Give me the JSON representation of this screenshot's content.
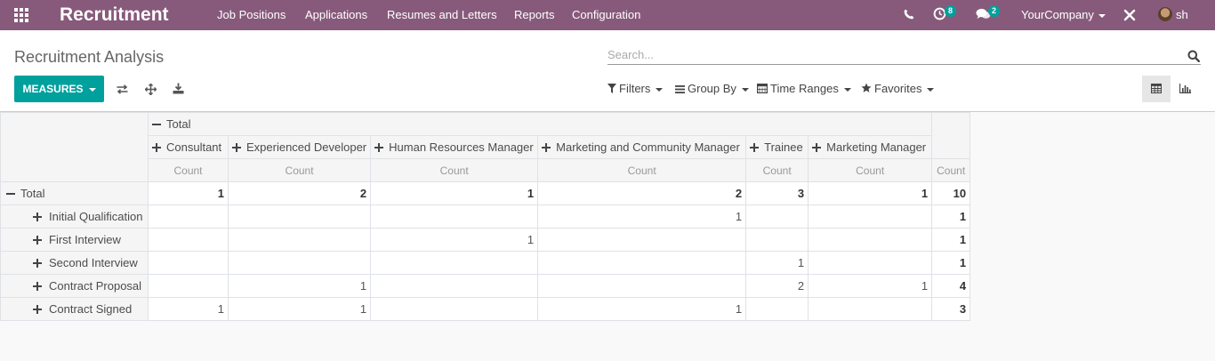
{
  "app": {
    "title": "Recruitment",
    "menu": [
      "Job Positions",
      "Applications",
      "Resumes and Letters",
      "Reports",
      "Configuration"
    ],
    "activity_count": "8",
    "message_count": "2",
    "company": "YourCompany",
    "user": "sh"
  },
  "page": {
    "title": "Recruitment Analysis",
    "search_placeholder": "Search...",
    "measures_label": "MEASURES",
    "filters": [
      "Filters",
      "Group By",
      "Time Ranges",
      "Favorites"
    ]
  },
  "pivot": {
    "col_total_label": "Total",
    "columns": [
      "Consultant",
      "Experienced Developer",
      "Human Resources Manager",
      "Marketing and Community Manager",
      "Trainee",
      "Marketing Manager"
    ],
    "measure": "Count",
    "rows": [
      {
        "label": "Total",
        "cells": [
          "1",
          "2",
          "1",
          "2",
          "3",
          "1"
        ],
        "total": "10"
      },
      {
        "label": "Initial Qualification",
        "cells": [
          "",
          "",
          "",
          "1",
          "",
          ""
        ],
        "total": "1"
      },
      {
        "label": "First Interview",
        "cells": [
          "",
          "",
          "1",
          "",
          "",
          ""
        ],
        "total": "1"
      },
      {
        "label": "Second Interview",
        "cells": [
          "",
          "",
          "",
          "",
          "1",
          ""
        ],
        "total": "1"
      },
      {
        "label": "Contract Proposal",
        "cells": [
          "",
          "1",
          "",
          "",
          "2",
          "1"
        ],
        "total": "4"
      },
      {
        "label": "Contract Signed",
        "cells": [
          "1",
          "1",
          "",
          "1",
          "",
          ""
        ],
        "total": "3"
      }
    ]
  },
  "colors": {
    "navbar": "#875a7b",
    "primary": "#00a09d"
  },
  "icons": {
    "apps": "apps-grid-icon",
    "phone": "phone-icon",
    "activity": "clock-icon",
    "messages": "chat-icon",
    "debug": "tools-icon",
    "flip": "flip-axis-icon",
    "expand": "expand-all-icon",
    "download": "download-icon",
    "search": "search-icon",
    "pivot_view": "table-icon",
    "graph_view": "bar-chart-icon"
  }
}
